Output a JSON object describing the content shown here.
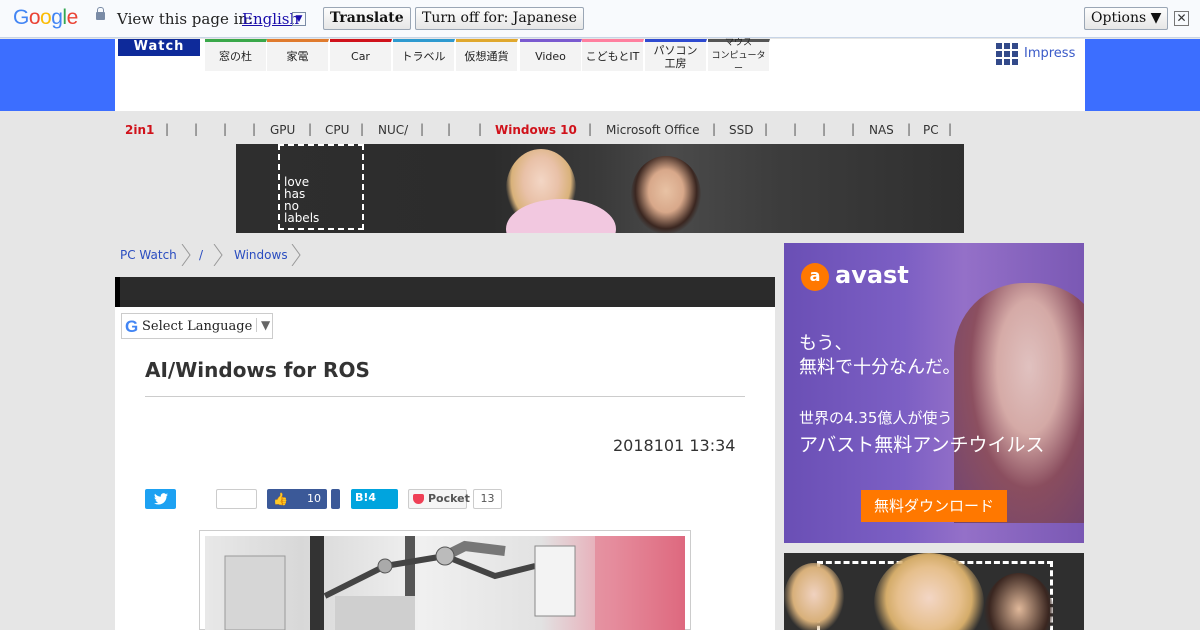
{
  "translate_bar": {
    "logo_letters": [
      "G",
      "o",
      "o",
      "g",
      "l",
      "e"
    ],
    "logo_colors": [
      "#4285f4",
      "#ea4335",
      "#fbbc05",
      "#4285f4",
      "#34a853",
      "#ea4335"
    ],
    "view_label": "View this page in:",
    "language": "English",
    "translate_button": "Translate",
    "turn_off_button": "Turn off for: Japanese",
    "options_button": "Options ▼",
    "close_glyph": "✕"
  },
  "header": {
    "logo": "Watch",
    "tabs": [
      {
        "label": "窓の杜",
        "color": "#3aa84a"
      },
      {
        "label": "家電",
        "color": "#e07b2e"
      },
      {
        "label": "Car",
        "color": "#d0121b"
      },
      {
        "label": "トラベル",
        "color": "#2e9ad0"
      },
      {
        "label": "仮想通貨",
        "color": "#e0a82e"
      },
      {
        "label": "Video",
        "color": "#7a5ad0"
      },
      {
        "label": "こどもとIT",
        "color": "#ff7f9f"
      },
      {
        "label": "パソコン\n工房",
        "color": "#2e4ad0"
      },
      {
        "label": "マウス\nコンピューター",
        "color": "#555555"
      }
    ],
    "impress_label": "Impress"
  },
  "categories": [
    {
      "label": "2in1",
      "hot": true
    },
    {
      "label": "",
      "hot": false
    },
    {
      "label": "",
      "hot": false
    },
    {
      "label": "",
      "hot": false
    },
    {
      "label": "GPU",
      "hot": false
    },
    {
      "label": "CPU",
      "hot": false
    },
    {
      "label": "NUC/",
      "hot": false
    },
    {
      "label": "",
      "hot": false
    },
    {
      "label": "",
      "hot": false
    },
    {
      "label": "Windows 10",
      "hot": true
    },
    {
      "label": "Microsoft Office",
      "hot": false
    },
    {
      "label": "SSD",
      "hot": false
    },
    {
      "label": "",
      "hot": false
    },
    {
      "label": "",
      "hot": false
    },
    {
      "label": "",
      "hot": false
    },
    {
      "label": "NAS",
      "hot": false
    },
    {
      "label": "PC",
      "hot": false
    }
  ],
  "banner": {
    "text_lines": [
      "love",
      "has",
      "no",
      "labels"
    ]
  },
  "breadcrumb": [
    "PC Watch",
    "/",
    "Windows"
  ],
  "article": {
    "select_language": "Select Language",
    "select_arrow": "▼",
    "title": "AI/Windows for ROS",
    "date": "2018101 13:34",
    "share": {
      "twitter_glyph": "🐦",
      "facebook_count": "10",
      "hatena_label": "B!",
      "hatena_count": "4",
      "pocket_label": "Pocket",
      "pocket_count": "13"
    }
  },
  "ad_avast": {
    "brand": "avast",
    "logo_glyph": "a",
    "line1": "もう、",
    "line2": "無料で十分なんだ。",
    "line3": "世界の4.35億人が使う",
    "line4": "アバスト無料アンチウイルス",
    "button": "無料ダウンロード"
  }
}
